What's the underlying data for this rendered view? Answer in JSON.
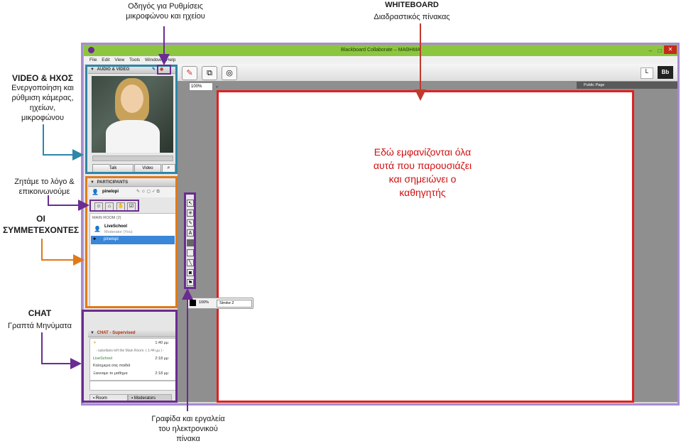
{
  "annotations": {
    "mic_guide": [
      "Οδηγός για Ρυθμίσεις",
      "μικροφώνου και ηχείου"
    ],
    "whiteboard_title": "WHITEBOARD",
    "whiteboard_sub": "Διαδραστικός πίνακας",
    "video_title": "VIDEO & ΗΧΟΣ",
    "video_desc": [
      "Ενεργοποίηση και",
      "ρύθμιση κάμερας,",
      "ηχείων,",
      "μικροφώνου"
    ],
    "talk_desc": [
      "Ζητάμε το λόγο &",
      "επικοινωνούμε"
    ],
    "participants_title": [
      "ΟΙ",
      "ΣΥΜΜΕΤΕΧΟΝΤΕΣ"
    ],
    "chat_title": "CHAT",
    "chat_desc": "Γραπτά Μηνύματα",
    "tools_desc": [
      "Γραφίδα και εργαλεία",
      "του ηλεκτρονικού",
      "πίνακα"
    ],
    "board_text": [
      "Εδώ εμφανίζονται όλα",
      "αυτά που παρουσιάζει",
      "και σημειώνει ο",
      "καθηγητής"
    ]
  },
  "colors": {
    "video_arrow": "#2e86a8",
    "mic_arrow": "#6a2c91",
    "participants_arrow": "#e07a1a",
    "chat_arrow": "#6a2c91",
    "board_border": "#e02020",
    "board_text": "#d01010"
  },
  "window": {
    "title": "Blackboard Collaborate – ΜΑΘΗΜΑ",
    "menu": [
      "File",
      "Edit",
      "View",
      "Tools",
      "Window",
      "Help"
    ]
  },
  "audio_video": {
    "header": "AUDIO & VIDEO",
    "talk_label": "Talk",
    "video_label": "Video"
  },
  "participants": {
    "header": "PARTICIPANTS",
    "self_name": "pinelopi",
    "room_label": "MAIN ROOM (2)",
    "list": [
      {
        "name": "LiveSchool",
        "role": "Moderator (You)"
      },
      {
        "name": "pinelopi",
        "role": ""
      }
    ]
  },
  "chat": {
    "header": "CHAT - Supervised",
    "messages": [
      {
        "text": "",
        "time": "1:40 μμ"
      },
      {
        "text": "- sakellaris left the Main Room. ( 1:44 μμ ) -",
        "time": ""
      },
      {
        "text": "LiveSchool",
        "time": "2:18 μμ"
      },
      {
        "text": "Καλημερα σας παιδιά",
        "time": ""
      },
      {
        "text": "Ξεκιναμε το μαθημα",
        "time": "2:18 μμ"
      }
    ],
    "tab_room": "Room",
    "tab_moderators": "Moderators"
  },
  "whiteboard": {
    "zoom": "100%",
    "page_label": "Public Page",
    "stroke_zoom": "100%",
    "stroke_label": "Stroke 2"
  }
}
